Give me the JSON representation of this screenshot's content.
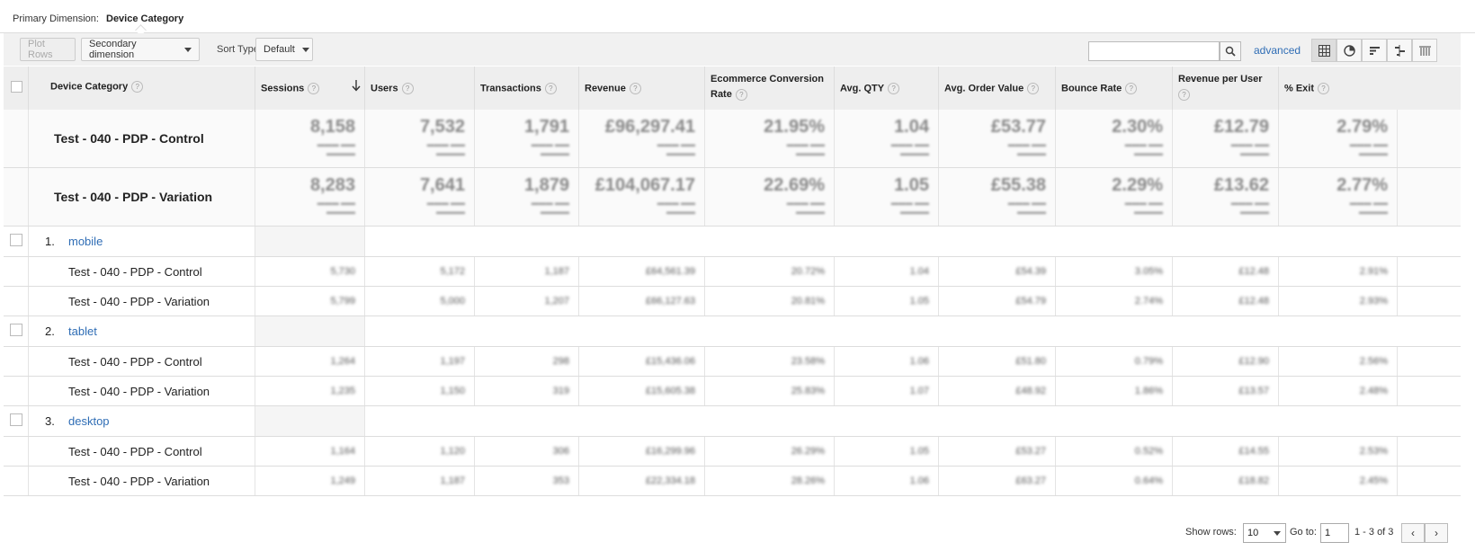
{
  "primary_dimension": {
    "label": "Primary Dimension:",
    "value": "Device Category"
  },
  "toolbar": {
    "plot_rows": "Plot Rows",
    "secondary_dimension": "Secondary dimension",
    "sort_type_label": "Sort Type:",
    "sort_type_value": "Default",
    "search_value": "",
    "advanced": "advanced",
    "views": [
      "table-icon",
      "pie-icon",
      "bar-icon",
      "comparison-icon",
      "pivot-icon"
    ]
  },
  "columns": {
    "device": "Device Category",
    "sessions": "Sessions",
    "users": "Users",
    "transactions": "Transactions",
    "revenue": "Revenue",
    "conversion_1": "Ecommerce Conversion",
    "conversion_2": "Rate",
    "avg_qty": "Avg. QTY",
    "avg_order": "Avg. Order Value",
    "bounce": "Bounce Rate",
    "rev_user": "Revenue per User",
    "exit": "% Exit",
    "help": "?"
  },
  "totals": [
    {
      "name": "Test - 040 - PDP - Control",
      "values": [
        "8,158",
        "7,532",
        "1,791",
        "£96,297.41",
        "21.95%",
        "1.04",
        "£53.77",
        "2.30%",
        "£12.79",
        "2.79%"
      ]
    },
    {
      "name": "Test - 040 - PDP - Variation",
      "values": [
        "8,283",
        "7,641",
        "1,879",
        "£104,067.17",
        "22.69%",
        "1.05",
        "£55.38",
        "2.29%",
        "£13.62",
        "2.77%"
      ]
    }
  ],
  "groups": [
    {
      "num": "1.",
      "name": "mobile",
      "rows": [
        {
          "name": "Test - 040 - PDP - Control",
          "values": [
            "5,730",
            "5,172",
            "1,187",
            "£64,561.39",
            "20.72%",
            "1.04",
            "£54.39",
            "3.05%",
            "£12.48",
            "2.91%"
          ]
        },
        {
          "name": "Test - 040 - PDP - Variation",
          "values": [
            "5,799",
            "5,000",
            "1,207",
            "£66,127.63",
            "20.81%",
            "1.05",
            "£54.79",
            "2.74%",
            "£12.48",
            "2.93%"
          ]
        }
      ]
    },
    {
      "num": "2.",
      "name": "tablet",
      "rows": [
        {
          "name": "Test - 040 - PDP - Control",
          "values": [
            "1,264",
            "1,197",
            "298",
            "£15,436.06",
            "23.58%",
            "1.06",
            "£51.80",
            "0.79%",
            "£12.90",
            "2.56%"
          ]
        },
        {
          "name": "Test - 040 - PDP - Variation",
          "values": [
            "1,235",
            "1,150",
            "319",
            "£15,605.38",
            "25.83%",
            "1.07",
            "£48.92",
            "1.86%",
            "£13.57",
            "2.48%"
          ]
        }
      ]
    },
    {
      "num": "3.",
      "name": "desktop",
      "rows": [
        {
          "name": "Test - 040 - PDP - Control",
          "values": [
            "1,164",
            "1,120",
            "306",
            "£16,299.96",
            "26.29%",
            "1.05",
            "£53.27",
            "0.52%",
            "£14.55",
            "2.53%"
          ]
        },
        {
          "name": "Test - 040 - PDP - Variation",
          "values": [
            "1,249",
            "1,187",
            "353",
            "£22,334.18",
            "28.26%",
            "1.06",
            "£63.27",
            "0.64%",
            "£18.82",
            "2.45%"
          ]
        }
      ]
    }
  ],
  "footer": {
    "show_rows_label": "Show rows:",
    "show_rows_value": "10",
    "goto_label": "Go to:",
    "goto_value": "1",
    "page_info": "1 - 3 of 3"
  }
}
